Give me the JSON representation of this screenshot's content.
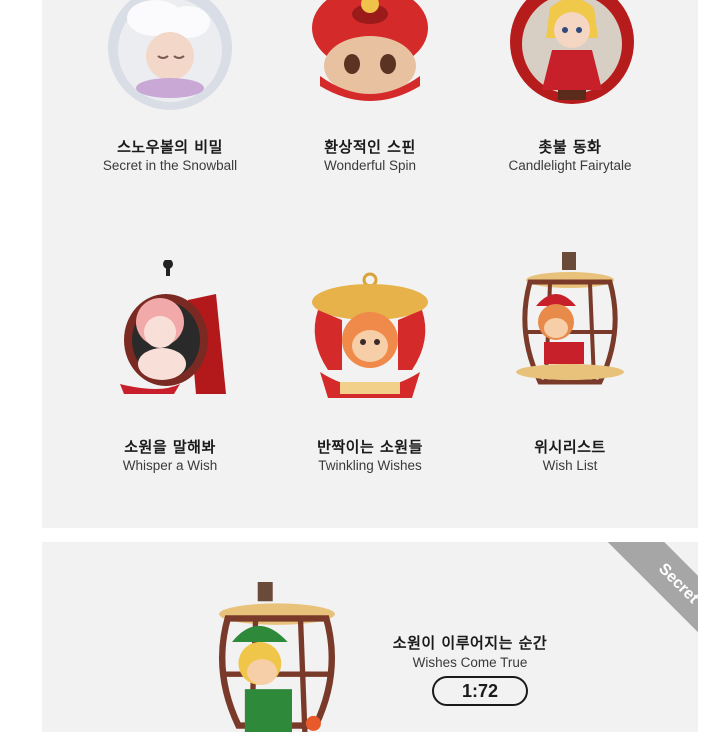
{
  "figures": [
    {
      "name_ko": "스노우볼의 비밀",
      "name_en": "Secret in the Snowball",
      "icon": "snowball-figure-icon"
    },
    {
      "name_ko": "환상적인 스핀",
      "name_en": "Wonderful Spin",
      "icon": "spinning-top-figure-icon"
    },
    {
      "name_ko": "촛불 동화",
      "name_en": "Candlelight Fairytale",
      "icon": "apple-girl-figure-icon"
    },
    {
      "name_ko": "소원을 말해봐",
      "name_en": "Whisper a Wish",
      "icon": "devil-girl-figure-icon"
    },
    {
      "name_ko": "반짝이는 소원들",
      "name_en": "Twinkling Wishes",
      "icon": "ornament-shell-figure-icon"
    },
    {
      "name_ko": "위시리스트",
      "name_en": "Wish List",
      "icon": "cage-boy-figure-icon"
    }
  ],
  "secret": {
    "badge": "Secret",
    "name_ko": "소원이 이루어지는 순간",
    "name_en": "Wishes Come True",
    "ratio": "1:72",
    "icon": "green-elf-figure-icon"
  },
  "colors": {
    "panel": "#f2f2f2",
    "badge": "#a6a6a6",
    "accent_red": "#c8202a"
  }
}
